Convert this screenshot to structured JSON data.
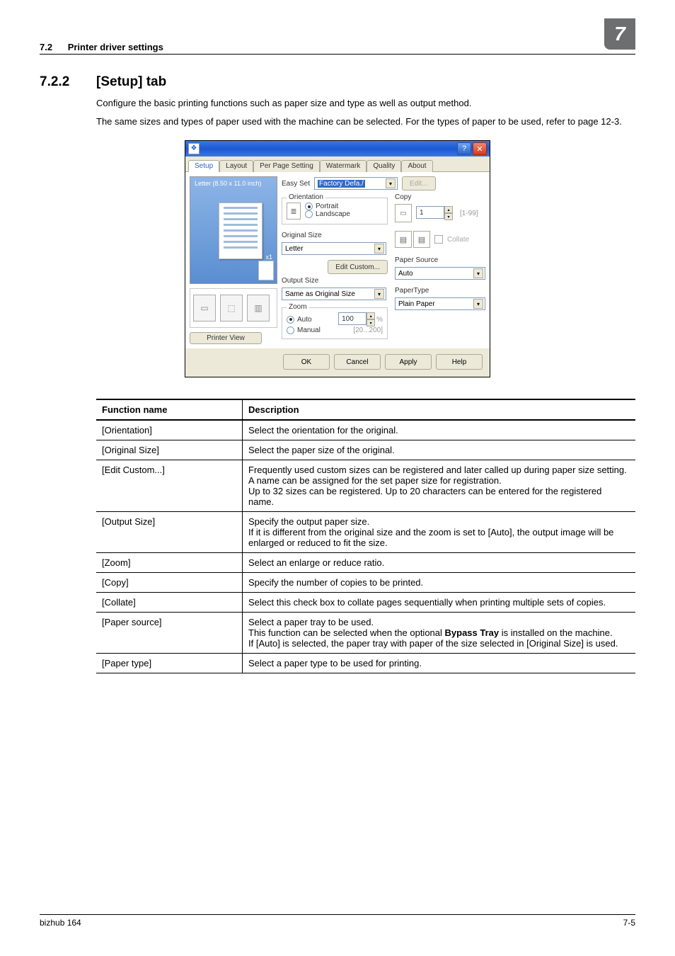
{
  "header": {
    "section_number": "7.2",
    "section_title": "Printer driver settings",
    "chapter_badge": "7"
  },
  "heading": {
    "number": "7.2.2",
    "title": "[Setup] tab"
  },
  "intro": {
    "p1": "Configure the basic printing functions such as paper size and type as well as output method.",
    "p2": "The same sizes and types of paper used with the machine can be selected. For the types of paper to be used, refer to page 12-3."
  },
  "dialog": {
    "tabs": {
      "active": "Setup",
      "t2": "Layout",
      "t3": "Per Page Setting",
      "t4": "Watermark",
      "t5": "Quality",
      "t6": "About"
    },
    "preview": {
      "size_label": "Letter (8.50 x 11.0 inch)",
      "mult": "x1",
      "printer_view_btn": "Printer View"
    },
    "easy_set": {
      "label": "Easy Set",
      "selected": "Factory Defa./",
      "edit_btn": "Edit..."
    },
    "orientation": {
      "group": "Orientation",
      "portrait": "Portrait",
      "landscape": "Landscape"
    },
    "original_size": {
      "label": "Original Size",
      "value": "Letter",
      "edit_custom_btn": "Edit Custom..."
    },
    "output_size": {
      "label": "Output Size",
      "value": "Same as Original Size"
    },
    "zoom": {
      "group": "Zoom",
      "auto": "Auto",
      "manual": "Manual",
      "value": "100",
      "range": "[20...200]"
    },
    "copy": {
      "label": "Copy",
      "value": "1",
      "range": "[1-99]"
    },
    "collate": {
      "label": "Collate"
    },
    "paper_source": {
      "label": "Paper Source",
      "value": "Auto"
    },
    "paper_type": {
      "label": "PaperType",
      "value": "Plain Paper"
    },
    "buttons": {
      "ok": "OK",
      "cancel": "Cancel",
      "apply": "Apply",
      "help": "Help"
    },
    "appicon_glyph": "❖",
    "help_glyph": "?",
    "close_glyph": "✕"
  },
  "table": {
    "head": {
      "c1": "Function name",
      "c2": "Description"
    },
    "rows": [
      {
        "name": "[Orientation]",
        "desc": "Select the orientation for the original."
      },
      {
        "name": "[Original Size]",
        "desc": "Select the paper size of the original."
      },
      {
        "name": "[Edit Custom...]",
        "desc": "Frequently used custom sizes can be registered and later called up during paper size setting.\nA name can be assigned for the set paper size for registration.\nUp to 32 sizes can be registered. Up to 20 characters can be entered for the registered name."
      },
      {
        "name": "[Output Size]",
        "desc": "Specify the output paper size.\nIf it is different from the original size and the zoom is set to [Auto], the output image will be enlarged or reduced to fit the size."
      },
      {
        "name": "[Zoom]",
        "desc": "Select an enlarge or reduce ratio."
      },
      {
        "name": "[Copy]",
        "desc": "Specify the number of copies to be printed."
      },
      {
        "name": "[Collate]",
        "desc": "Select this check box to collate pages sequentially when printing multiple sets of copies."
      },
      {
        "name": "[Paper source]",
        "desc_pre": "Select a paper tray to be used.\nThis function can be selected when the optional ",
        "desc_bold": "Bypass Tray",
        "desc_post": " is installed on the machine.\nIf [Auto] is selected, the paper tray with paper of the size selected in [Original Size] is used."
      },
      {
        "name": "[Paper type]",
        "desc": "Select a paper type to be used for printing."
      }
    ]
  },
  "footer": {
    "left": "bizhub 164",
    "right": "7-5"
  }
}
